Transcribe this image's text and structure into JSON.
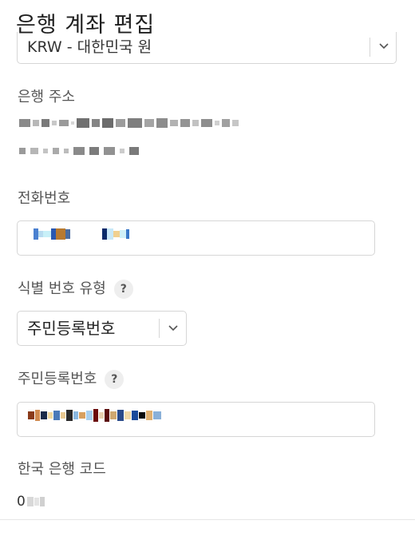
{
  "header": {
    "title": "은행 계좌 편집"
  },
  "currency": {
    "value": "KRW - 대한민국 원"
  },
  "bank_address": {
    "label": "은행 주소"
  },
  "phone": {
    "label": "전화번호"
  },
  "id_type": {
    "label": "식별 번호 유형",
    "help": "?",
    "value": "주민등록번호"
  },
  "id_number": {
    "label": "주민등록번호",
    "help": "?"
  },
  "bank_code": {
    "label": "한국 은행 코드",
    "value_prefix": "0"
  },
  "icons": {
    "chevron": "chevron-down-icon",
    "help": "help-icon"
  }
}
